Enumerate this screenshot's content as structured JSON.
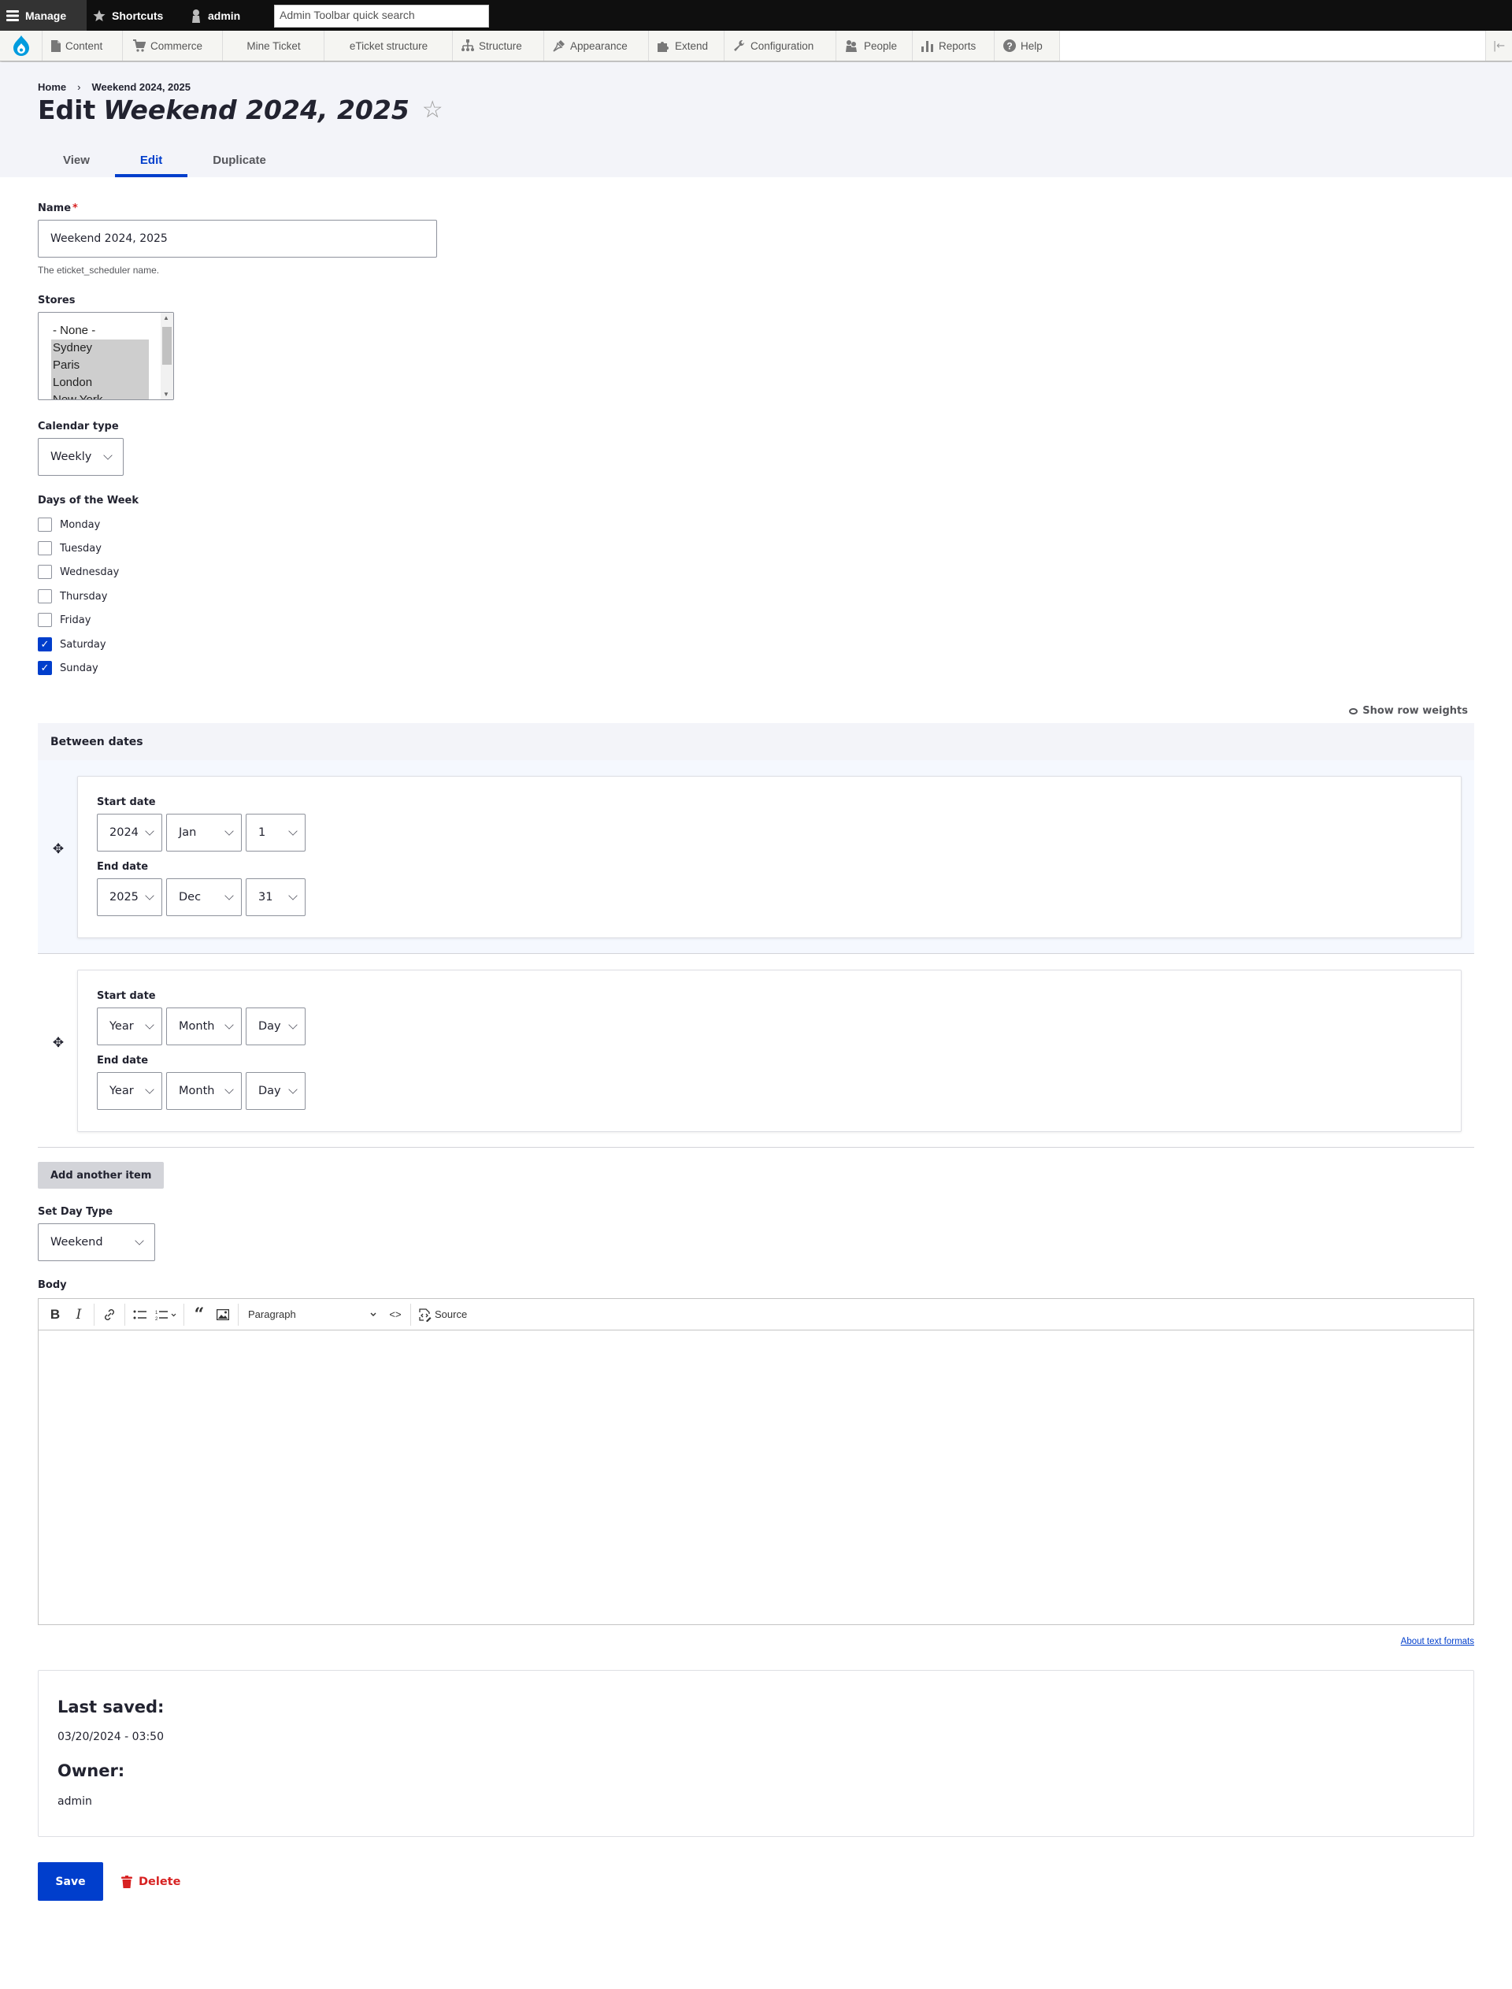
{
  "admin_toolbar": {
    "manage_label": "Manage",
    "shortcuts_label": "Shortcuts",
    "user_label": "admin",
    "search_placeholder": "Admin Toolbar quick search",
    "tray_items": [
      {
        "label": "Content",
        "icon": "file-icon"
      },
      {
        "label": "Commerce",
        "icon": "cart-icon"
      },
      {
        "label": "Mine Ticket",
        "icon": ""
      },
      {
        "label": "eTicket structure",
        "icon": ""
      },
      {
        "label": "Structure",
        "icon": "sitemap-icon"
      },
      {
        "label": "Appearance",
        "icon": "brush-icon"
      },
      {
        "label": "Extend",
        "icon": "puzzle-icon"
      },
      {
        "label": "Configuration",
        "icon": "wrench-icon"
      },
      {
        "label": "People",
        "icon": "people-icon"
      },
      {
        "label": "Reports",
        "icon": "bar-chart-icon"
      },
      {
        "label": "Help",
        "icon": "help-icon"
      }
    ]
  },
  "header": {
    "breadcrumb": [
      {
        "label": "Home"
      },
      {
        "label": "Weekend 2024, 2025"
      }
    ],
    "breadcrumb_separator": "›",
    "title_prefix": "Edit",
    "title_entity": "Weekend 2024, 2025",
    "tabs": [
      {
        "label": "View",
        "active": false
      },
      {
        "label": "Edit",
        "active": true
      },
      {
        "label": "Duplicate",
        "active": false
      }
    ]
  },
  "form": {
    "name": {
      "label": "Name",
      "required_marker": "*",
      "value": "Weekend 2024, 2025",
      "description": "The eticket_scheduler name."
    },
    "stores": {
      "label": "Stores",
      "options": [
        {
          "label": "- None -",
          "selected": false
        },
        {
          "label": "Sydney",
          "selected": true
        },
        {
          "label": "Paris",
          "selected": true
        },
        {
          "label": "London",
          "selected": true
        },
        {
          "label": "New York",
          "selected": true
        }
      ]
    },
    "calendar_type": {
      "label": "Calendar type",
      "value": "Weekly"
    },
    "days_of_week": {
      "label": "Days of the Week",
      "days": [
        {
          "label": "Monday",
          "checked": false
        },
        {
          "label": "Tuesday",
          "checked": false
        },
        {
          "label": "Wednesday",
          "checked": false
        },
        {
          "label": "Thursday",
          "checked": false
        },
        {
          "label": "Friday",
          "checked": false
        },
        {
          "label": "Saturday",
          "checked": true
        },
        {
          "label": "Sunday",
          "checked": true
        }
      ],
      "check_mark": "✓"
    },
    "between_dates": {
      "show_row_weights_label": "Show row weights",
      "header": "Between dates",
      "start_label": "Start date",
      "end_label": "End date",
      "rows": [
        {
          "start": {
            "year": "2024",
            "month": "Jan",
            "day": "1"
          },
          "end": {
            "year": "2025",
            "month": "Dec",
            "day": "31"
          }
        },
        {
          "start": {
            "year": "Year",
            "month": "Month",
            "day": "Day"
          },
          "end": {
            "year": "Year",
            "month": "Month",
            "day": "Day"
          }
        }
      ],
      "add_another_label": "Add another item"
    },
    "day_type": {
      "label": "Set Day Type",
      "value": "Weekend"
    },
    "body": {
      "label": "Body",
      "toolbar": {
        "bold": "B",
        "italic": "I",
        "heading_value": "Paragraph",
        "source_label": "Source"
      },
      "content": "",
      "about_formats_label": "About text formats"
    },
    "meta": {
      "last_saved_label": "Last saved:",
      "last_saved_value": "03/20/2024 - 03:50",
      "owner_label": "Owner:",
      "owner_value": "admin"
    },
    "actions": {
      "save_label": "Save",
      "delete_label": "Delete"
    }
  },
  "colors": {
    "primary": "#003ecc",
    "danger": "#d72222",
    "header_bg": "#f3f4f9",
    "toolbar_bg": "#0f0f0f",
    "drupal_blue": "#009cde"
  }
}
